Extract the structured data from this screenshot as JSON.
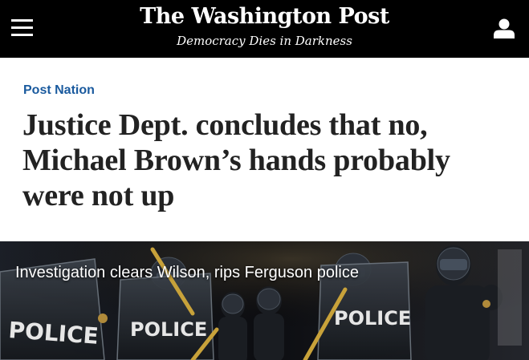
{
  "header": {
    "masthead": "The Washington Post",
    "tagline": "Democracy Dies in Darkness",
    "menu_icon": "hamburger-menu-icon",
    "user_icon": "user-account-icon"
  },
  "article": {
    "section": "Post Nation",
    "headline": "Justice Dept. concludes that no, Michael Brown’s hands probably were not up"
  },
  "photo": {
    "caption": "Investigation clears Wilson, rips Ferguson police",
    "shield_labels": [
      "POLICE",
      "POLICE",
      "POLICE"
    ]
  },
  "colors": {
    "header_bg": "#000000",
    "section_link": "#1a5a9e",
    "headline_text": "#222222"
  }
}
